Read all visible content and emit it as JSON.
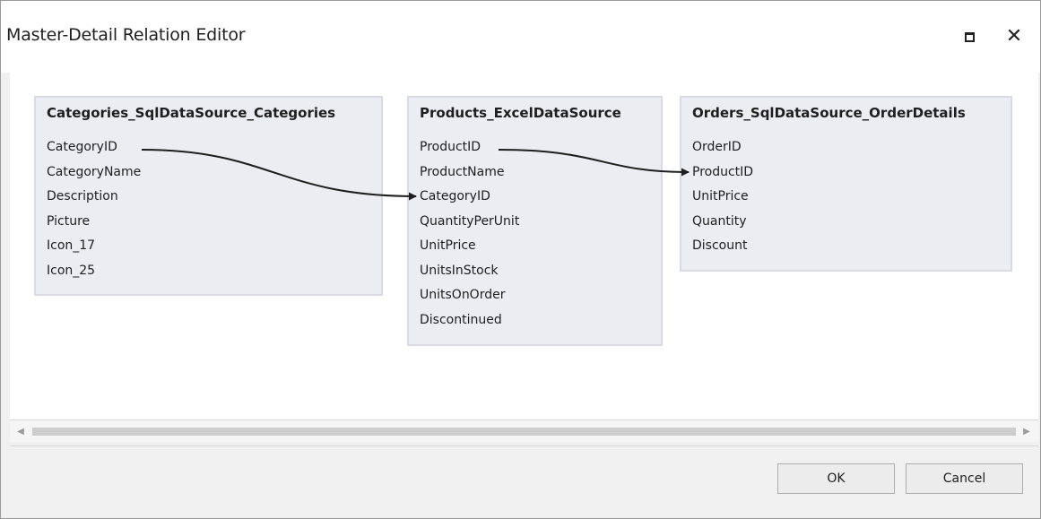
{
  "window": {
    "title": "Master-Detail Relation Editor",
    "maximize_icon": "maximize-icon",
    "close_icon": "close-icon",
    "close_glyph": "✕"
  },
  "tables": [
    {
      "title": "Categories_SqlDataSource_Categories",
      "fields": [
        "CategoryID",
        "CategoryName",
        "Description",
        "Picture",
        "Icon_17",
        "Icon_25"
      ]
    },
    {
      "title": "Products_ExcelDataSource",
      "fields": [
        "ProductID",
        "ProductName",
        "CategoryID",
        "QuantityPerUnit",
        "UnitPrice",
        "UnitsInStock",
        "UnitsOnOrder",
        "Discontinued"
      ]
    },
    {
      "title": "Orders_SqlDataSource_OrderDetails",
      "fields": [
        "OrderID",
        "ProductID",
        "UnitPrice",
        "Quantity",
        "Discount"
      ]
    }
  ],
  "relations": [
    {
      "from_table": "Categories_SqlDataSource_Categories",
      "from_field": "CategoryID",
      "to_table": "Products_ExcelDataSource",
      "to_field": "CategoryID"
    },
    {
      "from_table": "Products_ExcelDataSource",
      "from_field": "ProductID",
      "to_table": "Orders_SqlDataSource_OrderDetails",
      "to_field": "ProductID"
    }
  ],
  "scrollbar": {
    "left_arrow": "◀",
    "right_arrow": "▶"
  },
  "buttons": {
    "ok_label": "OK",
    "cancel_label": "Cancel"
  },
  "colors": {
    "table_background": "#ececf3",
    "connector": "#1e1e1e"
  }
}
